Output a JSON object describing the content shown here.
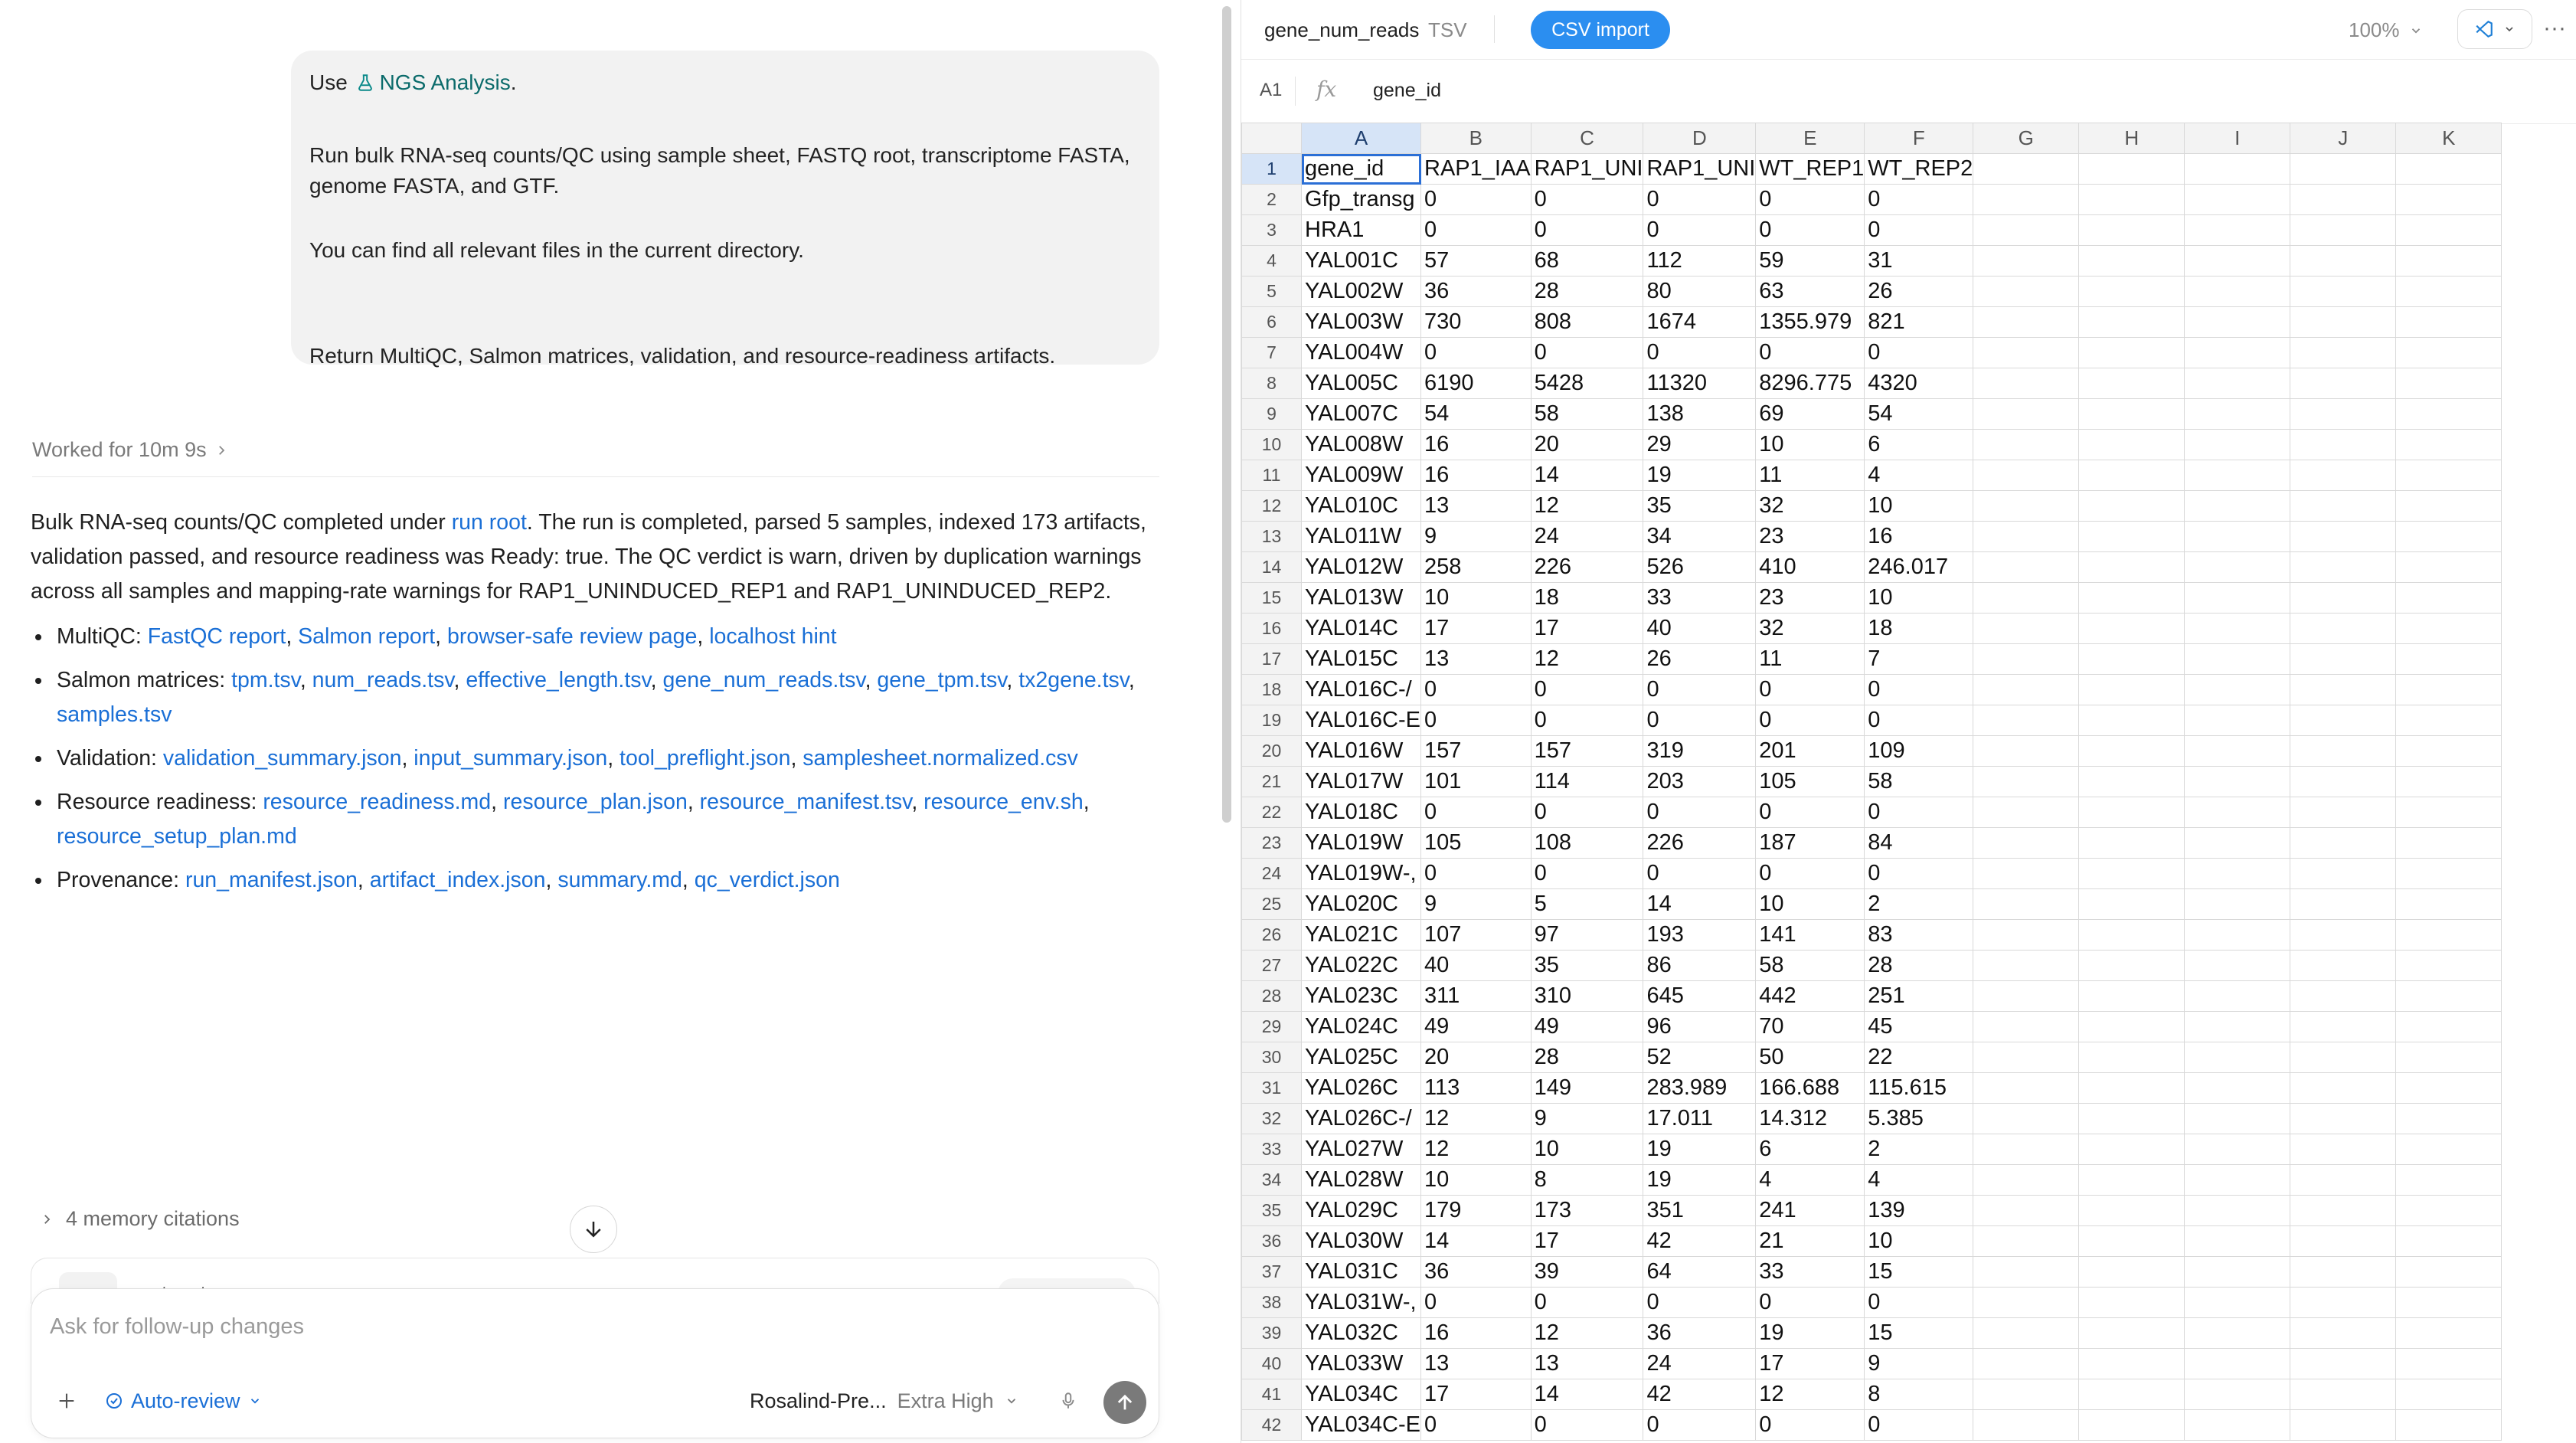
{
  "chat": {
    "user_message": {
      "prefix": "Use",
      "skill_name": "NGS Analysis",
      "suffix": ".",
      "line2": "Run bulk RNA-seq counts/QC using sample sheet, FASTQ root, transcriptome FASTA, genome FASTA, and GTF.",
      "line3": "You can find all relevant files in the current directory.",
      "line4": "Return MultiQC, Salmon matrices, validation, and resource-readiness artifacts."
    },
    "worked_for": "Worked for 10m 9s",
    "answer": {
      "intro_before_link": "Bulk RNA-seq counts/QC completed under",
      "run_root_link": "run root",
      "intro_after_link": ". The run is completed, parsed 5 samples, indexed 173 artifacts, validation passed, and resource readiness was Ready: true. The QC verdict is warn, driven by duplication warnings across all samples and mapping-rate warnings for RAP1_UNINDUCED_REP1 and RAP1_UNINDUCED_REP2.",
      "bullets": [
        {
          "label": "MultiQC:",
          "links": [
            "FastQC report",
            "Salmon report",
            "browser-safe review page",
            "localhost hint"
          ]
        },
        {
          "label": "Salmon matrices:",
          "links": [
            "tpm.tsv",
            "num_reads.tsv",
            "effective_length.tsv",
            "gene_num_reads.tsv",
            "gene_tpm.tsv",
            "tx2gene.tsv",
            "samples.tsv"
          ]
        },
        {
          "label": "Validation:",
          "links": [
            "validation_summary.json",
            "input_summary.json",
            "tool_preflight.json",
            "samplesheet.normalized.csv"
          ]
        },
        {
          "label": "Resource readiness:",
          "links": [
            "resource_readiness.md",
            "resource_plan.json",
            "resource_manifest.tsv",
            "resource_env.sh",
            "resource_setup_plan.md"
          ]
        },
        {
          "label": "Provenance:",
          "links": [
            "run_manifest.json",
            "artifact_index.json",
            "summary.md",
            "qc_verdict.json"
          ]
        }
      ]
    },
    "memory_citations": "4 memory citations",
    "peek_file": "tpm.tsv",
    "composer": {
      "placeholder": "Ask for follow-up changes",
      "auto_review": "Auto-review",
      "model": "Rosalind-Pre...",
      "effort": "Extra High"
    }
  },
  "sheet": {
    "file_name": "gene_num_reads",
    "file_type": "TSV",
    "import_button": "CSV import",
    "zoom": "100%",
    "cell_ref": "A1",
    "fx_label": "fx",
    "formula_value": "gene_id",
    "columns": [
      "A",
      "B",
      "C",
      "D",
      "E",
      "F",
      "G",
      "H",
      "I",
      "J",
      "K"
    ],
    "rows": [
      [
        "1",
        "gene_id",
        "RAP1_IAA",
        "RAP1_UNI",
        "RAP1_UNI",
        "WT_REP1",
        "WT_REP2"
      ],
      [
        "2",
        "Gfp_transg",
        "0",
        "0",
        "0",
        "0",
        "0"
      ],
      [
        "3",
        "HRA1",
        "0",
        "0",
        "0",
        "0",
        "0"
      ],
      [
        "4",
        "YAL001C",
        "57",
        "68",
        "112",
        "59",
        "31"
      ],
      [
        "5",
        "YAL002W",
        "36",
        "28",
        "80",
        "63",
        "26"
      ],
      [
        "6",
        "YAL003W",
        "730",
        "808",
        "1674",
        "1355.979",
        "821"
      ],
      [
        "7",
        "YAL004W",
        "0",
        "0",
        "0",
        "0",
        "0"
      ],
      [
        "8",
        "YAL005C",
        "6190",
        "5428",
        "11320",
        "8296.775",
        "4320"
      ],
      [
        "9",
        "YAL007C",
        "54",
        "58",
        "138",
        "69",
        "54"
      ],
      [
        "10",
        "YAL008W",
        "16",
        "20",
        "29",
        "10",
        "6"
      ],
      [
        "11",
        "YAL009W",
        "16",
        "14",
        "19",
        "11",
        "4"
      ],
      [
        "12",
        "YAL010C",
        "13",
        "12",
        "35",
        "32",
        "10"
      ],
      [
        "13",
        "YAL011W",
        "9",
        "24",
        "34",
        "23",
        "16"
      ],
      [
        "14",
        "YAL012W",
        "258",
        "226",
        "526",
        "410",
        "246.017"
      ],
      [
        "15",
        "YAL013W",
        "10",
        "18",
        "33",
        "23",
        "10"
      ],
      [
        "16",
        "YAL014C",
        "17",
        "17",
        "40",
        "32",
        "18"
      ],
      [
        "17",
        "YAL015C",
        "13",
        "12",
        "26",
        "11",
        "7"
      ],
      [
        "18",
        "YAL016C-/",
        "0",
        "0",
        "0",
        "0",
        "0"
      ],
      [
        "19",
        "YAL016C-E",
        "0",
        "0",
        "0",
        "0",
        "0"
      ],
      [
        "20",
        "YAL016W",
        "157",
        "157",
        "319",
        "201",
        "109"
      ],
      [
        "21",
        "YAL017W",
        "101",
        "114",
        "203",
        "105",
        "58"
      ],
      [
        "22",
        "YAL018C",
        "0",
        "0",
        "0",
        "0",
        "0"
      ],
      [
        "23",
        "YAL019W",
        "105",
        "108",
        "226",
        "187",
        "84"
      ],
      [
        "24",
        "YAL019W-,",
        "0",
        "0",
        "0",
        "0",
        "0"
      ],
      [
        "25",
        "YAL020C",
        "9",
        "5",
        "14",
        "10",
        "2"
      ],
      [
        "26",
        "YAL021C",
        "107",
        "97",
        "193",
        "141",
        "83"
      ],
      [
        "27",
        "YAL022C",
        "40",
        "35",
        "86",
        "58",
        "28"
      ],
      [
        "28",
        "YAL023C",
        "311",
        "310",
        "645",
        "442",
        "251"
      ],
      [
        "29",
        "YAL024C",
        "49",
        "49",
        "96",
        "70",
        "45"
      ],
      [
        "30",
        "YAL025C",
        "20",
        "28",
        "52",
        "50",
        "22"
      ],
      [
        "31",
        "YAL026C",
        "113",
        "149",
        "283.989",
        "166.688",
        "115.615"
      ],
      [
        "32",
        "YAL026C-/",
        "12",
        "9",
        "17.011",
        "14.312",
        "5.385"
      ],
      [
        "33",
        "YAL027W",
        "12",
        "10",
        "19",
        "6",
        "2"
      ],
      [
        "34",
        "YAL028W",
        "10",
        "8",
        "19",
        "4",
        "4"
      ],
      [
        "35",
        "YAL029C",
        "179",
        "173",
        "351",
        "241",
        "139"
      ],
      [
        "36",
        "YAL030W",
        "14",
        "17",
        "42",
        "21",
        "10"
      ],
      [
        "37",
        "YAL031C",
        "36",
        "39",
        "64",
        "33",
        "15"
      ],
      [
        "38",
        "YAL031W-,",
        "0",
        "0",
        "0",
        "0",
        "0"
      ],
      [
        "39",
        "YAL032C",
        "16",
        "12",
        "36",
        "19",
        "15"
      ],
      [
        "40",
        "YAL033W",
        "13",
        "13",
        "24",
        "17",
        "9"
      ],
      [
        "41",
        "YAL034C",
        "17",
        "14",
        "42",
        "12",
        "8"
      ],
      [
        "42",
        "YAL034C-E",
        "0",
        "0",
        "0",
        "0",
        "0"
      ]
    ]
  },
  "colors": {
    "link": "#1a6fd6",
    "accent_button": "#2b8ef0",
    "selection": "#2b6fd6"
  }
}
